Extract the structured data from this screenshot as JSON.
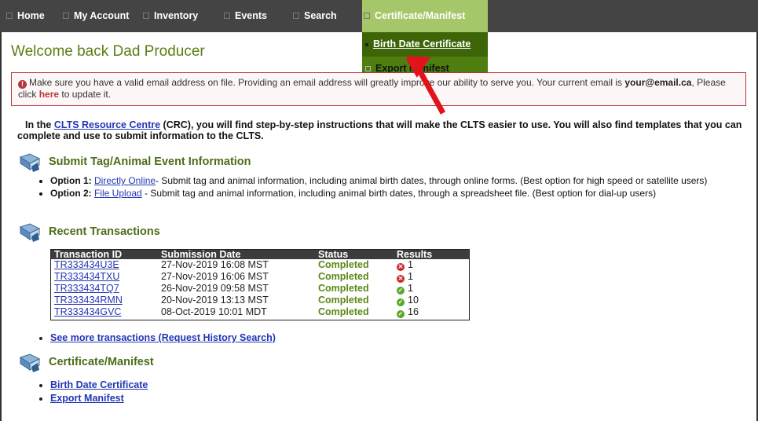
{
  "nav": {
    "items": [
      "Home",
      "My Account",
      "Inventory",
      "Events",
      "Search",
      "Certificate/Manifest"
    ]
  },
  "dropdown": {
    "items": [
      "Birth Date Certificate",
      "Export Manifest"
    ]
  },
  "welcome": "Welcome back  Dad Producer",
  "alert": {
    "text_before": "Make sure you have a valid email address on file. Providing an email address will greatly improve our ability to serve you. Your current email is",
    "email": "your@email.ca",
    "text_mid": ", Please click",
    "link": "here",
    "text_after": "to update it."
  },
  "intro": {
    "lead": "In the",
    "link": "CLTS Resource Centre",
    "rest": "(CRC), you will find step-by-step instructions that will make the CLTS easier to use. You will also find templates that you can complete and use to submit information to the CLTS."
  },
  "submit_section": {
    "title": "Submit Tag/Animal Event Information",
    "options": [
      {
        "label": "Option 1:",
        "link": "Directly Online",
        "text": "- Submit tag and animal information, including animal birth dates, through online forms. (Best option for high speed or satellite users)"
      },
      {
        "label": "Option 2:",
        "link": "File Upload",
        "text": "- Submit tag and animal information, including animal birth dates, through a spreadsheet file. (Best option for dial-up users)"
      }
    ]
  },
  "recent_section": {
    "title": "Recent Transactions",
    "headers": [
      "Transaction ID",
      "Submission Date",
      "Status",
      "Results"
    ],
    "rows": [
      {
        "id": "TR333434U3E",
        "date": "27-Nov-2019 16:08 MST",
        "status": "Completed",
        "result": "1",
        "result_type": "error"
      },
      {
        "id": "TR333434TXU",
        "date": "27-Nov-2019 16:06 MST",
        "status": "Completed",
        "result": "1",
        "result_type": "error"
      },
      {
        "id": "TR333434TQ7",
        "date": "26-Nov-2019 09:58 MST",
        "status": "Completed",
        "result": "1",
        "result_type": "ok"
      },
      {
        "id": "TR333434RMN",
        "date": "20-Nov-2019 13:13 MST",
        "status": "Completed",
        "result": "10",
        "result_type": "ok"
      },
      {
        "id": "TR333434GVC",
        "date": "08-Oct-2019 10:01 MDT",
        "status": "Completed",
        "result": "16",
        "result_type": "ok"
      }
    ],
    "more_link": "See more transactions (Request History Search)"
  },
  "cert_section": {
    "title": "Certificate/Manifest",
    "links": [
      "Birth Date Certificate",
      "Export Manifest"
    ]
  },
  "colors": {
    "nav_bg": "#444444",
    "nav_active": "#a6c66a",
    "dropdown_bg": "#4b7a0b",
    "section_title": "#4c6e18",
    "alert_border": "#b5373c",
    "link": "#2336b5",
    "arrow": "#e0141a"
  }
}
